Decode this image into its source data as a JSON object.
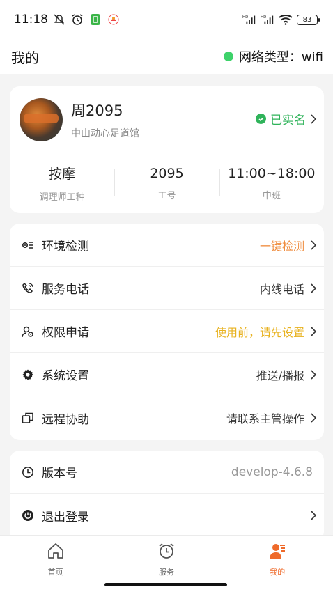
{
  "status_bar": {
    "time": "11:18",
    "battery": "83"
  },
  "header": {
    "title": "我的",
    "network_label": "网络类型：wifi",
    "network_status_color": "#3ed26a"
  },
  "profile": {
    "name": "周2095",
    "shop": "中山动心足道馆",
    "verified_label": "已实名",
    "stats": [
      {
        "value": "按摩",
        "label": "调理师工种"
      },
      {
        "value": "2095",
        "label": "工号"
      },
      {
        "value": "11:00~18:00",
        "label": "中班"
      }
    ]
  },
  "menu": {
    "items": [
      {
        "icon": "environment-check-icon",
        "label": "环境检测",
        "value": "一键检测",
        "value_color": "#ef8a3a"
      },
      {
        "icon": "phone-icon",
        "label": "服务电话",
        "value": "内线电话"
      },
      {
        "icon": "user-permission-icon",
        "label": "权限申请",
        "value": "使用前，请先设置",
        "value_color": "#e8b21f"
      },
      {
        "icon": "gear-icon",
        "label": "系统设置",
        "value": "推送/播报"
      },
      {
        "icon": "remote-assist-icon",
        "label": "远程协助",
        "value": "请联系主管操作"
      }
    ]
  },
  "info": {
    "version_label": "版本号",
    "version_value": "develop-4.6.8",
    "logout_label": "退出登录"
  },
  "bottom_nav": {
    "items": [
      {
        "icon": "home-icon",
        "label": "首页"
      },
      {
        "icon": "alarm-clock-icon",
        "label": "服务"
      },
      {
        "icon": "profile-icon",
        "label": "我的",
        "active": true
      }
    ],
    "active_color": "#ef6a2a"
  }
}
